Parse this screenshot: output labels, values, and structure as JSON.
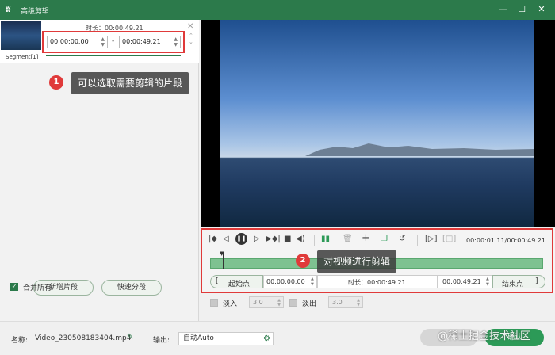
{
  "window": {
    "title": "高级剪辑",
    "logo_glyph": "ʬ",
    "min_glyph": "—",
    "max_glyph": "☐",
    "close_glyph": "✕"
  },
  "segment": {
    "duration_label": "时长：00:00:49.21",
    "start_time": "00:00:00.00",
    "end_time": "00:00:49.21",
    "dash": "-",
    "label": "Segment[1]"
  },
  "annotations": {
    "one": {
      "number": "1",
      "text": "可以选取需要剪辑的片段"
    },
    "two": {
      "number": "2",
      "text": "对视频进行剪辑"
    }
  },
  "left_buttons": {
    "new_segment": "新增片段",
    "quick_split": "快速分段"
  },
  "merge_all": {
    "label": "合并所有",
    "checked": true
  },
  "player": {
    "time_readout": "00:00:01.11/00:00:49.21"
  },
  "range": {
    "start_bracket": "[",
    "start_label": "起始点",
    "start_value": "00:00:00.00",
    "duration_label": "时长：00:00:49.21",
    "end_value": "00:00:49.21",
    "end_label": "结束点",
    "end_bracket": "]"
  },
  "fade": {
    "fade_in_label": "淡入",
    "fade_in_value": "3.0",
    "fade_out_label": "淡出",
    "fade_out_value": "3.0"
  },
  "bottom": {
    "name_label": "名称:",
    "name_value": "Video_230508183404.mp4",
    "output_label": "输出:",
    "output_value": "自动Auto",
    "cancel_label": "取消",
    "ok_label": "确认"
  },
  "watermark": "@稀土掘金技术社区",
  "colors": {
    "brand_green": "#2c7a4b",
    "accent_red": "#e03a3a",
    "track_green": "#7ec291"
  }
}
